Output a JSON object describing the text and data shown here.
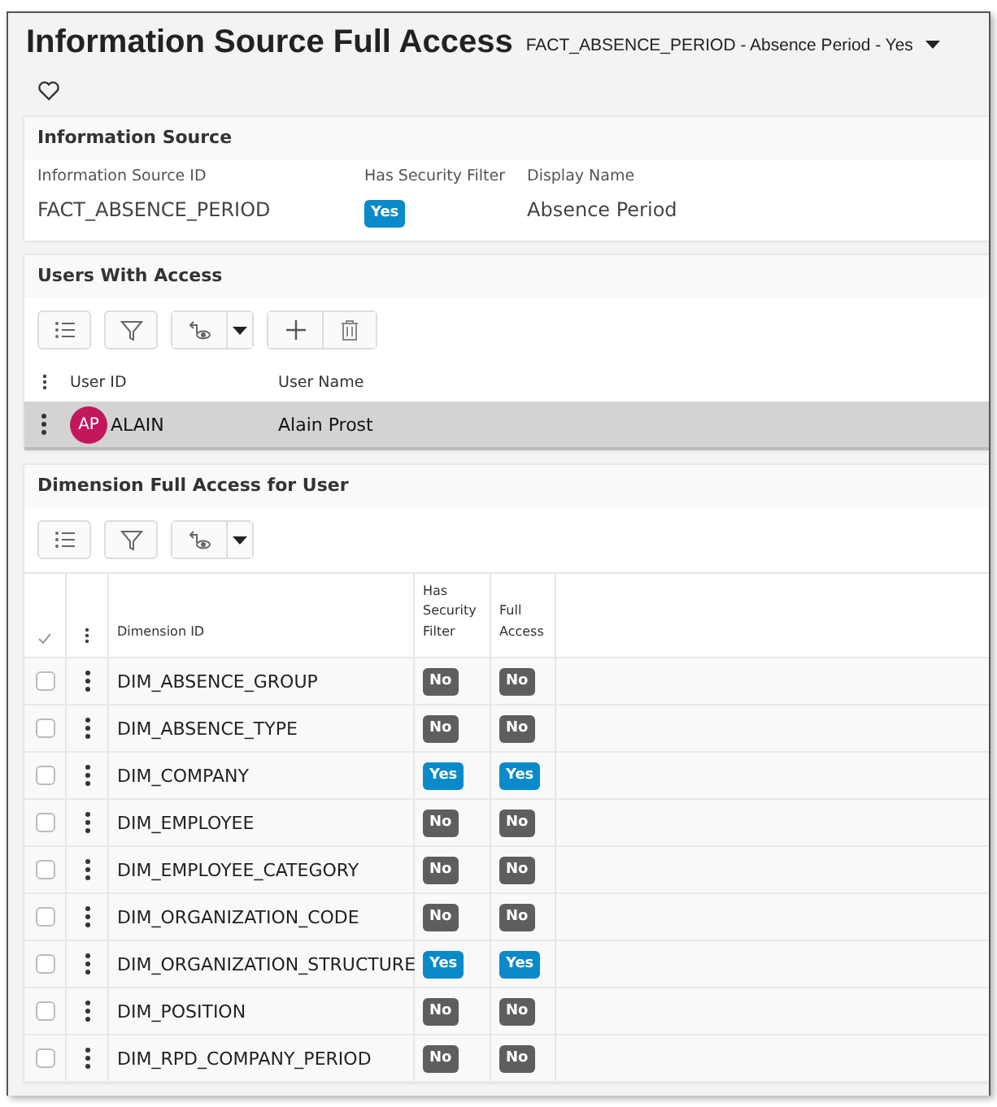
{
  "page": {
    "title": "Information Source Full Access",
    "context": "FACT_ABSENCE_PERIOD - Absence Period - Yes"
  },
  "information_source": {
    "heading": "Information Source",
    "fields": [
      {
        "label": "Information Source ID",
        "kind": "text",
        "value": "FACT_ABSENCE_PERIOD"
      },
      {
        "label": "Has Security Filter",
        "kind": "badge",
        "value": "Yes",
        "on": true
      },
      {
        "label": "Display Name",
        "kind": "text",
        "value": "Absence Period"
      }
    ]
  },
  "users_with_access": {
    "heading": "Users With Access",
    "columns": [
      "User ID",
      "User Name"
    ],
    "rows": [
      {
        "initials": "AP",
        "color": "#c2185b",
        "user_id": "ALAIN",
        "user_name": "Alain Prost",
        "selected": true
      }
    ]
  },
  "dimension_access": {
    "heading": "Dimension Full Access for User",
    "columns": [
      "Dimension ID",
      "Has Security Filter",
      "Full Access"
    ],
    "rows": [
      {
        "dimension_id": "DIM_ABSENCE_GROUP",
        "checked": false,
        "has_security_filter": {
          "text": "No",
          "on": false
        },
        "full_access": {
          "text": "No",
          "on": false
        }
      },
      {
        "dimension_id": "DIM_ABSENCE_TYPE",
        "checked": false,
        "has_security_filter": {
          "text": "No",
          "on": false
        },
        "full_access": {
          "text": "No",
          "on": false
        }
      },
      {
        "dimension_id": "DIM_COMPANY",
        "checked": false,
        "has_security_filter": {
          "text": "Yes",
          "on": true
        },
        "full_access": {
          "text": "Yes",
          "on": true
        }
      },
      {
        "dimension_id": "DIM_EMPLOYEE",
        "checked": false,
        "has_security_filter": {
          "text": "No",
          "on": false
        },
        "full_access": {
          "text": "No",
          "on": false
        }
      },
      {
        "dimension_id": "DIM_EMPLOYEE_CATEGORY",
        "checked": false,
        "has_security_filter": {
          "text": "No",
          "on": false
        },
        "full_access": {
          "text": "No",
          "on": false
        }
      },
      {
        "dimension_id": "DIM_ORGANIZATION_CODE",
        "checked": false,
        "has_security_filter": {
          "text": "No",
          "on": false
        },
        "full_access": {
          "text": "No",
          "on": false
        }
      },
      {
        "dimension_id": "DIM_ORGANIZATION_STRUCTURE",
        "checked": false,
        "has_security_filter": {
          "text": "Yes",
          "on": true
        },
        "full_access": {
          "text": "Yes",
          "on": true
        }
      },
      {
        "dimension_id": "DIM_POSITION",
        "checked": false,
        "has_security_filter": {
          "text": "No",
          "on": false
        },
        "full_access": {
          "text": "No",
          "on": false
        }
      },
      {
        "dimension_id": "DIM_RPD_COMPANY_PERIOD",
        "checked": false,
        "has_security_filter": {
          "text": "No",
          "on": false
        },
        "full_access": {
          "text": "No",
          "on": false
        }
      }
    ]
  }
}
